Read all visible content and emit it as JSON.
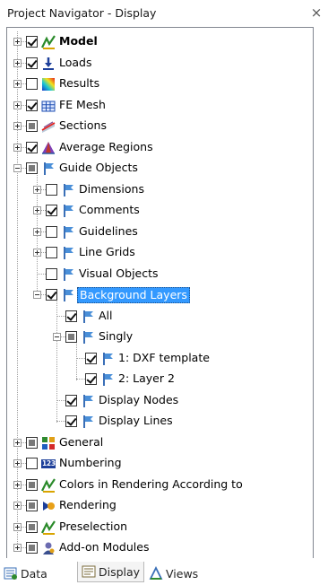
{
  "window": {
    "title": "Project Navigator - Display",
    "close_glyph": "×"
  },
  "tree": [
    {
      "label": "Model",
      "bold": true,
      "check": "checked",
      "icon": "model-icon",
      "expander": "plus",
      "level": 0
    },
    {
      "label": "Loads",
      "check": "checked",
      "icon": "loads-icon",
      "expander": "plus",
      "level": 0
    },
    {
      "label": "Results",
      "check": "unchecked",
      "icon": "results-icon",
      "expander": "plus",
      "level": 0
    },
    {
      "label": "FE Mesh",
      "check": "checked",
      "icon": "fe-mesh-icon",
      "expander": "plus",
      "level": 0
    },
    {
      "label": "Sections",
      "check": "partial",
      "icon": "sections-icon",
      "expander": "plus",
      "level": 0
    },
    {
      "label": "Average Regions",
      "check": "checked",
      "icon": "average-regions-icon",
      "expander": "plus",
      "level": 0
    },
    {
      "label": "Guide Objects",
      "check": "partial",
      "icon": "guide-objects-icon",
      "expander": "minus",
      "level": 0
    },
    {
      "label": "Dimensions",
      "check": "unchecked",
      "icon": "guide-objects-icon",
      "expander": "plus",
      "level": 1
    },
    {
      "label": "Comments",
      "check": "checked",
      "icon": "guide-objects-icon",
      "expander": "plus",
      "level": 1
    },
    {
      "label": "Guidelines",
      "check": "unchecked",
      "icon": "guide-objects-icon",
      "expander": "plus",
      "level": 1
    },
    {
      "label": "Line Grids",
      "check": "unchecked",
      "icon": "guide-objects-icon",
      "expander": "plus",
      "level": 1
    },
    {
      "label": "Visual Objects",
      "check": "unchecked",
      "icon": "guide-objects-icon",
      "expander": "none",
      "level": 1
    },
    {
      "label": "Background Layers",
      "check": "checked",
      "icon": "guide-objects-icon",
      "expander": "minus",
      "level": 1,
      "selected": true
    },
    {
      "label": "All",
      "check": "checked",
      "icon": "guide-objects-icon",
      "expander": "none",
      "level": 2
    },
    {
      "label": "Singly",
      "check": "partial",
      "icon": "guide-objects-icon",
      "expander": "minus",
      "level": 2
    },
    {
      "label": "1: DXF template",
      "check": "checked",
      "icon": "guide-objects-icon",
      "expander": "none",
      "level": 3
    },
    {
      "label": "2: Layer 2",
      "check": "checked",
      "icon": "guide-objects-icon",
      "expander": "none",
      "level": 3
    },
    {
      "label": "Display Nodes",
      "check": "checked",
      "icon": "guide-objects-icon",
      "expander": "none",
      "level": 2
    },
    {
      "label": "Display Lines",
      "check": "checked",
      "icon": "guide-objects-icon",
      "expander": "none",
      "level": 2
    },
    {
      "label": "General",
      "check": "partial",
      "icon": "general-icon",
      "expander": "plus",
      "level": 0
    },
    {
      "label": "Numbering",
      "check": "unchecked",
      "icon": "numbering-icon",
      "icon_text": "123",
      "expander": "plus",
      "level": 0
    },
    {
      "label": "Colors in Rendering According to",
      "check": "partial",
      "icon": "model-icon",
      "expander": "plus",
      "level": 0
    },
    {
      "label": "Rendering",
      "check": "partial",
      "icon": "rendering-icon",
      "expander": "plus",
      "level": 0
    },
    {
      "label": "Preselection",
      "check": "partial",
      "icon": "model-icon",
      "expander": "plus",
      "level": 0
    },
    {
      "label": "Add-on Modules",
      "check": "partial",
      "icon": "add-on-modules-icon",
      "expander": "plus",
      "level": 0
    }
  ],
  "tabs": [
    {
      "label": "Data",
      "icon": "data-tab-icon",
      "active": false
    },
    {
      "label": "Display",
      "icon": "display-tab-icon",
      "active": true
    },
    {
      "label": "Views",
      "icon": "views-tab-icon",
      "active": false
    }
  ]
}
